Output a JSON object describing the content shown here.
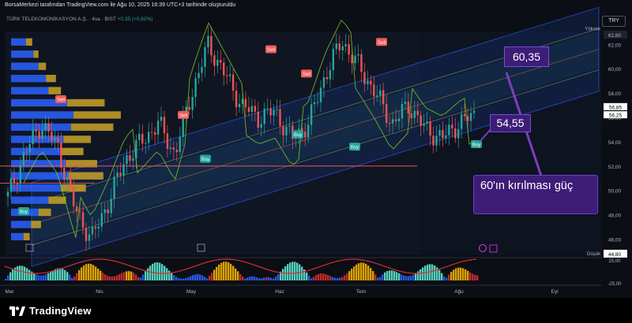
{
  "header": {
    "attribution": "BorsaMerkezi tarafından TradingView.com ile Ağu 10, 2025 16:39 UTC+3 tarihinde oluşturuldu",
    "symbol": "TÜRK TELEKOMÜNİKASYON A.Ş. · 4sa · BIST",
    "change": "+0,35 (+0,62%)",
    "currency": "TRY"
  },
  "price_axis": {
    "ticks": [
      "62,80",
      "62,00",
      "60,00",
      "58,00",
      "56,00",
      "54,00",
      "52,00",
      "50,00",
      "48,00",
      "46,00",
      "44,80"
    ],
    "high_label": "Yüksek",
    "low_label": "Düşük",
    "price_tags": [
      "56,85",
      "56,25"
    ],
    "osc_ticks": [
      "25,00",
      "-25,00"
    ]
  },
  "time_axis": {
    "labels": [
      "Mar",
      "Nis",
      "May",
      "Haz",
      "Tem",
      "Ağu",
      "Eyl"
    ]
  },
  "annotations": {
    "level_high": "60,35",
    "level_low": "54,55",
    "note": "60'ın kırılması güç"
  },
  "signals": {
    "sell": "Sell",
    "buy": "Buy"
  },
  "footer": {
    "brand": "TradingView"
  },
  "colors": {
    "up": "#26a69a",
    "down": "#ef5350",
    "channel": "#2962ff",
    "volume_up": "#c9a227",
    "volume_down": "#2962ff",
    "annotation": "#3d1d78"
  },
  "chart_data": {
    "type": "candlestick",
    "ylim": [
      44.8,
      62.8
    ],
    "x_labels": [
      "Mar",
      "Nis",
      "May",
      "Haz",
      "Tem",
      "Ağu",
      "Eyl"
    ],
    "close_path": [
      {
        "x": "Mar",
        "y": 49.5
      },
      {
        "x": "Mar",
        "y": 53.0
      },
      {
        "x": "Mar",
        "y": 55.5
      },
      {
        "x": "Mar",
        "y": 53.5
      },
      {
        "x": "Nis",
        "y": 48.5
      },
      {
        "x": "Nis",
        "y": 46.0
      },
      {
        "x": "Nis",
        "y": 49.0
      },
      {
        "x": "Nis",
        "y": 52.5
      },
      {
        "x": "May",
        "y": 54.0
      },
      {
        "x": "May",
        "y": 55.5
      },
      {
        "x": "May",
        "y": 53.0
      },
      {
        "x": "May",
        "y": 58.0
      },
      {
        "x": "May",
        "y": 62.0
      },
      {
        "x": "Haz",
        "y": 59.5
      },
      {
        "x": "Haz",
        "y": 57.0
      },
      {
        "x": "Haz",
        "y": 56.0
      },
      {
        "x": "Haz",
        "y": 56.5
      },
      {
        "x": "Haz",
        "y": 54.2
      },
      {
        "x": "Tem",
        "y": 55.5
      },
      {
        "x": "Tem",
        "y": 59.5
      },
      {
        "x": "Tem",
        "y": 62.3
      },
      {
        "x": "Tem",
        "y": 60.2
      },
      {
        "x": "Tem",
        "y": 58.0
      },
      {
        "x": "Tem",
        "y": 55.5
      },
      {
        "x": "Tem",
        "y": 57.0
      },
      {
        "x": "Ağu",
        "y": 55.0
      },
      {
        "x": "Ağu",
        "y": 54.3
      },
      {
        "x": "Ağu",
        "y": 55.5
      },
      {
        "x": "Ağu",
        "y": 56.3
      }
    ],
    "horizontal_levels": [
      60.35,
      54.55,
      52.0
    ],
    "volume_profile": [
      {
        "price": 62.0,
        "up": 5,
        "down": 12
      },
      {
        "price": 61.0,
        "up": 4,
        "down": 18
      },
      {
        "price": 60.0,
        "up": 6,
        "down": 22
      },
      {
        "price": 59.0,
        "up": 8,
        "down": 28
      },
      {
        "price": 58.0,
        "up": 10,
        "down": 30
      },
      {
        "price": 57.0,
        "up": 30,
        "down": 45
      },
      {
        "price": 56.0,
        "up": 38,
        "down": 50
      },
      {
        "price": 55.0,
        "up": 34,
        "down": 48
      },
      {
        "price": 54.0,
        "up": 22,
        "down": 42
      },
      {
        "price": 53.0,
        "up": 18,
        "down": 40
      },
      {
        "price": 52.0,
        "up": 25,
        "down": 44
      },
      {
        "price": 51.0,
        "up": 28,
        "down": 46
      },
      {
        "price": 50.0,
        "up": 20,
        "down": 40
      },
      {
        "price": 49.0,
        "up": 14,
        "down": 30
      },
      {
        "price": 48.0,
        "up": 10,
        "down": 22
      },
      {
        "price": 47.0,
        "up": 8,
        "down": 16
      },
      {
        "price": 46.0,
        "up": 5,
        "down": 10
      }
    ],
    "signals": [
      {
        "type": "Sell",
        "x": "Mar",
        "price": 57.5
      },
      {
        "type": "Buy",
        "x": "Mar",
        "price": 48.3
      },
      {
        "type": "Buy",
        "x": "Nis",
        "price": 52.6
      },
      {
        "type": "Sell",
        "x": "May",
        "price": 56.2
      },
      {
        "type": "Sell",
        "x": "May",
        "price": 61.6
      },
      {
        "type": "Buy",
        "x": "Haz",
        "price": 54.6
      },
      {
        "type": "Sell",
        "x": "Haz",
        "price": 59.6
      },
      {
        "type": "Sell",
        "x": "Tem",
        "price": 62.2
      },
      {
        "type": "Buy",
        "x": "Tem",
        "price": 53.6
      },
      {
        "type": "Buy",
        "x": "Ağu",
        "price": 53.8
      }
    ]
  }
}
